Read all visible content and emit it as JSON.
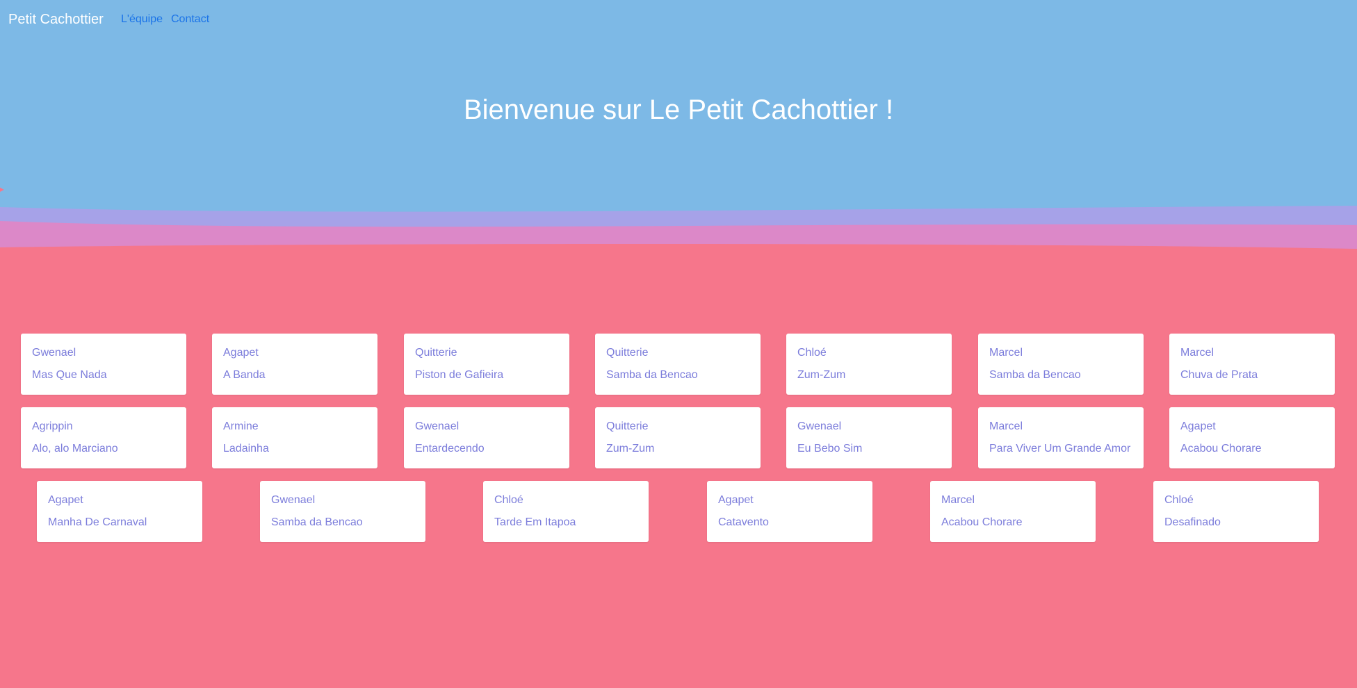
{
  "nav": {
    "brand": "Petit Cachottier",
    "links": [
      {
        "label": "L'équipe"
      },
      {
        "label": "Contact"
      }
    ]
  },
  "hero": {
    "title": "Bienvenue sur Le Petit Cachottier !"
  },
  "colors": {
    "hero_blue": "#7db9e6",
    "wave_purple": "#a6a2e8",
    "wave_pink": "#dc88c8",
    "page_pink": "#f6768b",
    "card_text": "#7c7ddb",
    "nav_link": "#1a73e8"
  },
  "cards": [
    {
      "artist": "Gwenael",
      "song": "Mas Que Nada"
    },
    {
      "artist": "Agapet",
      "song": "A Banda"
    },
    {
      "artist": "Quitterie",
      "song": "Piston de Gafieira"
    },
    {
      "artist": "Quitterie",
      "song": "Samba da Bencao"
    },
    {
      "artist": "Chloé",
      "song": "Zum-Zum"
    },
    {
      "artist": "Marcel",
      "song": "Samba da Bencao"
    },
    {
      "artist": "Marcel",
      "song": "Chuva de Prata"
    },
    {
      "artist": "Agrippin",
      "song": "Alo, alo Marciano"
    },
    {
      "artist": "Armine",
      "song": "Ladainha"
    },
    {
      "artist": "Gwenael",
      "song": "Entardecendo"
    },
    {
      "artist": "Quitterie",
      "song": "Zum-Zum"
    },
    {
      "artist": "Gwenael",
      "song": "Eu Bebo Sim"
    },
    {
      "artist": "Marcel",
      "song": "Para Viver Um Grande Amor"
    },
    {
      "artist": "Agapet",
      "song": "Acabou Chorare"
    },
    {
      "artist": "Agapet",
      "song": "Manha De Carnaval"
    },
    {
      "artist": "Gwenael",
      "song": "Samba da Bencao"
    },
    {
      "artist": "Chloé",
      "song": "Tarde Em Itapoa"
    },
    {
      "artist": "Agapet",
      "song": "Catavento"
    },
    {
      "artist": "Marcel",
      "song": "Acabou Chorare"
    },
    {
      "artist": "Chloé",
      "song": "Desafinado"
    }
  ]
}
